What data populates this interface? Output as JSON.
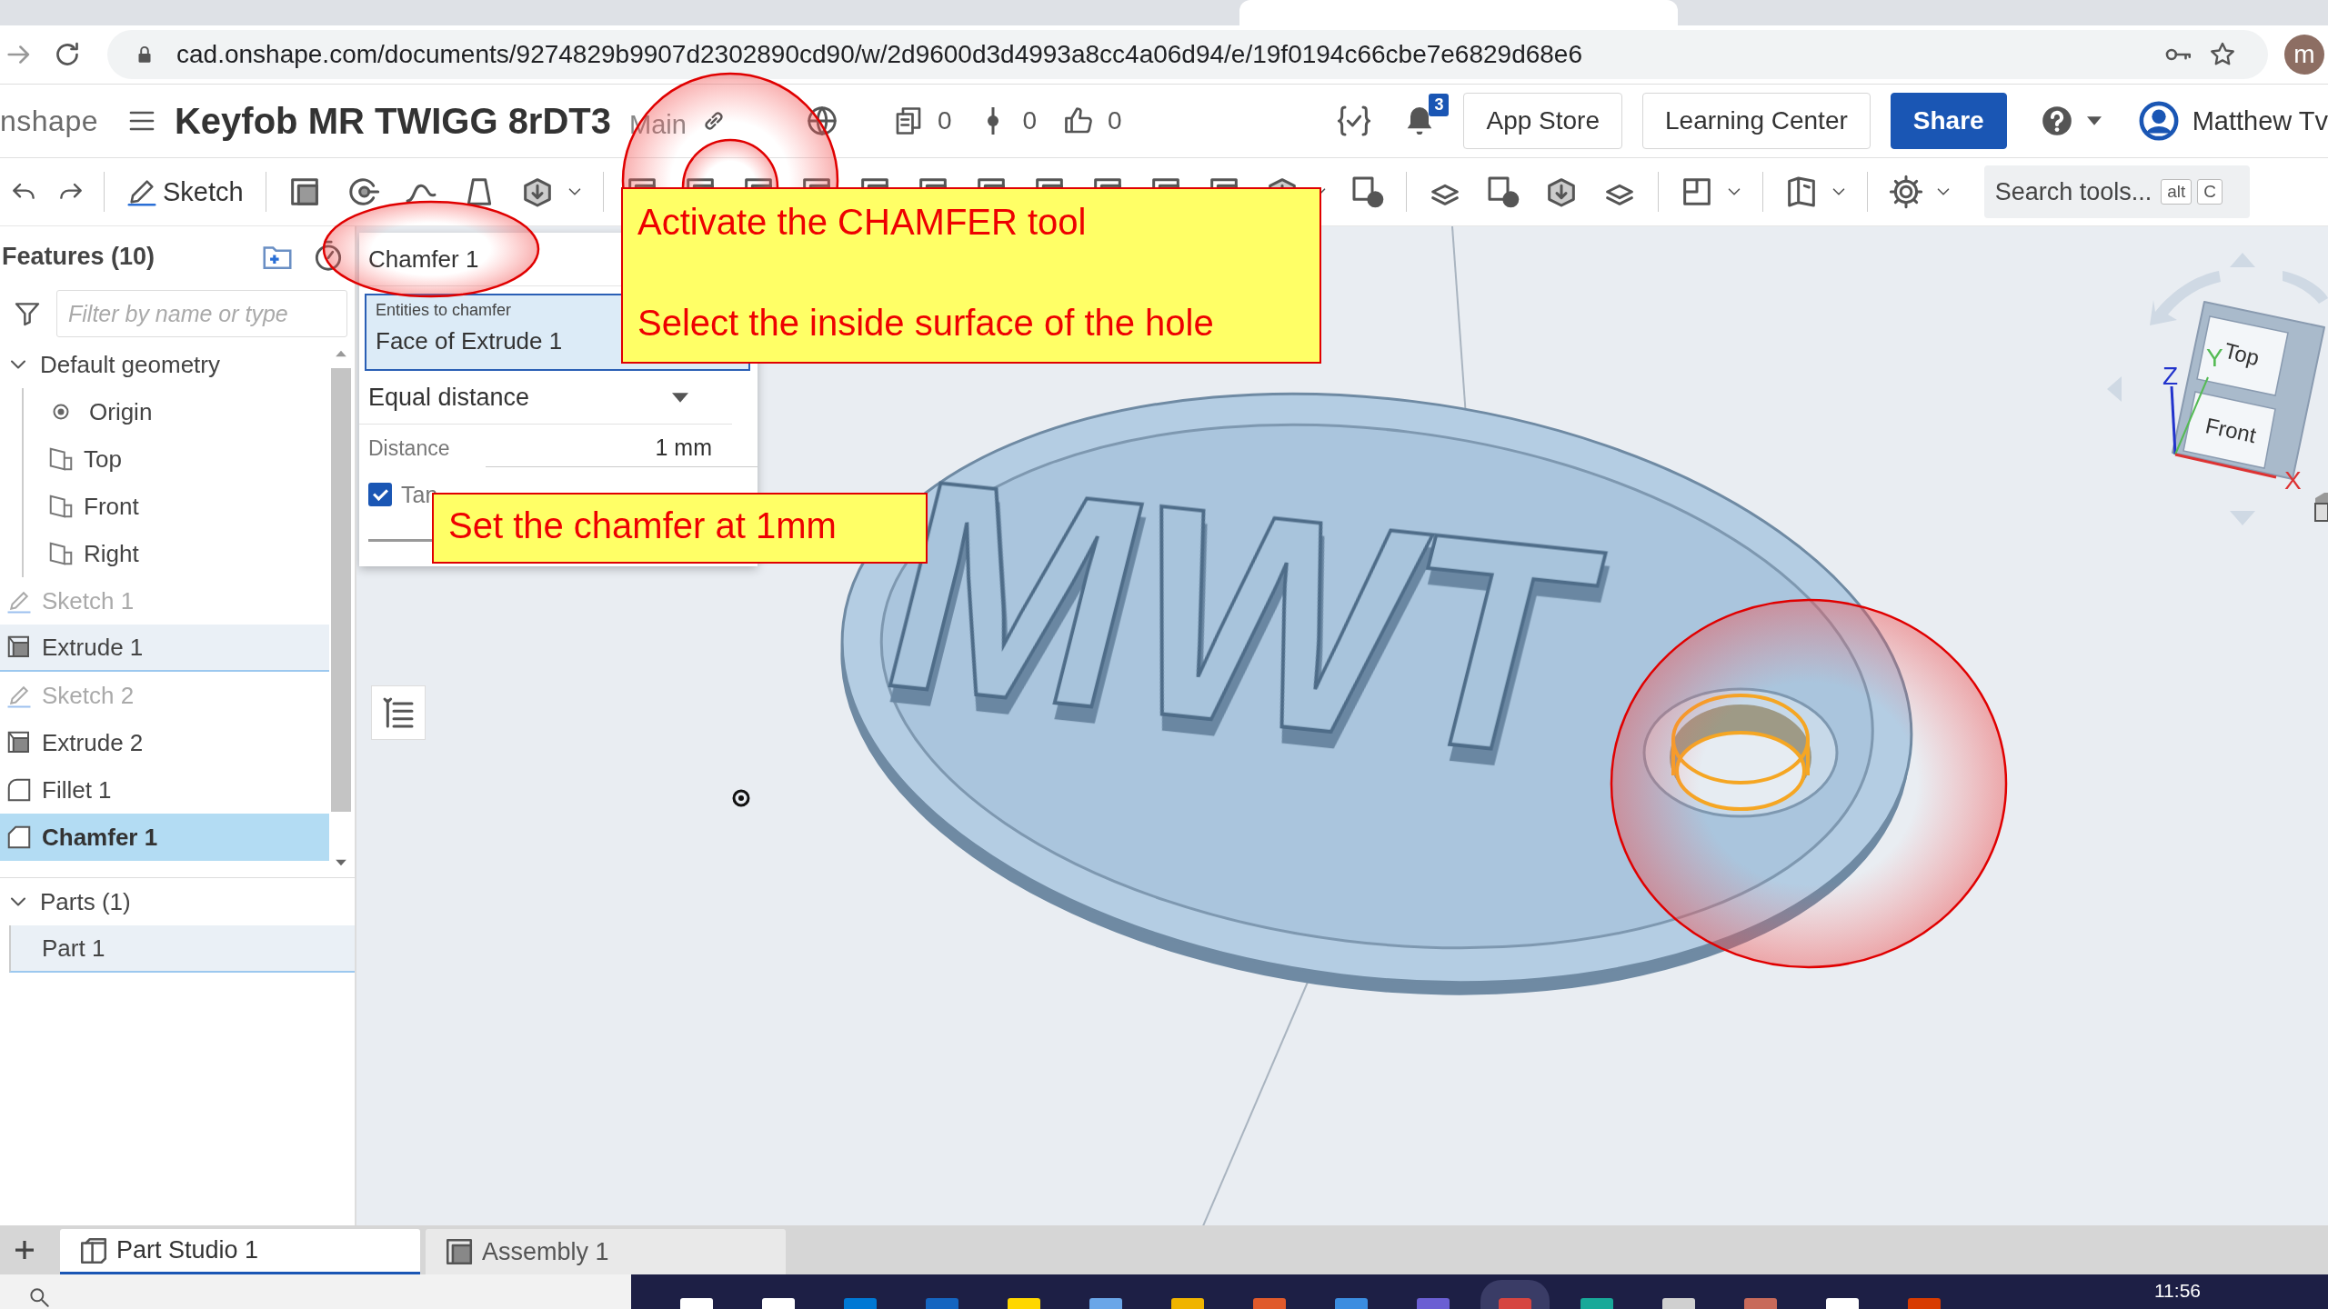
{
  "address_bar": {
    "url": "cad.onshape.com/documents/9274829b9907d2302890cd90/w/2d9600d3d4993a8cc4a06d94/e/19f0194c66cbe7e6829d68e6",
    "profile_initial": "m"
  },
  "header": {
    "logo": "nshape",
    "document_title": "Keyfob MR TWIGG 8rDT3",
    "branch": "Main",
    "counters": [
      {
        "kind": "documents",
        "value": "0"
      },
      {
        "kind": "versions",
        "value": "0"
      },
      {
        "kind": "likes",
        "value": "0"
      }
    ],
    "notification_count": "3",
    "buttons": [
      {
        "label": "App Store",
        "kind": "outline"
      },
      {
        "label": "Learning Center",
        "kind": "outline"
      },
      {
        "label": "Share",
        "kind": "primary"
      }
    ],
    "user": "Matthew Tv"
  },
  "toolbar": {
    "sketch_label": "Sketch",
    "search": {
      "placeholder": "Search tools...",
      "keys": [
        "alt",
        "C"
      ]
    }
  },
  "features": {
    "title": "Features (10)",
    "filter_placeholder": "Filter by name or type",
    "items": [
      {
        "label": "Default geometry",
        "kind": "group",
        "expanded": true,
        "selected": false,
        "highlighted": false,
        "hidden": false,
        "children": [
          {
            "label": "Origin",
            "kind": "origin"
          },
          {
            "label": "Top",
            "kind": "plane"
          },
          {
            "label": "Front",
            "kind": "plane"
          },
          {
            "label": "Right",
            "kind": "plane"
          }
        ]
      },
      {
        "label": "Sketch 1",
        "kind": "sketch",
        "selected": false,
        "highlighted": false,
        "hidden": true
      },
      {
        "label": "Extrude 1",
        "kind": "extrude",
        "selected": false,
        "highlighted": true,
        "hidden": false
      },
      {
        "label": "Sketch 2",
        "kind": "sketch",
        "selected": false,
        "highlighted": false,
        "hidden": true
      },
      {
        "label": "Extrude 2",
        "kind": "extrude",
        "selected": false,
        "highlighted": false,
        "hidden": false
      },
      {
        "label": "Fillet 1",
        "kind": "fillet",
        "selected": false,
        "highlighted": false,
        "hidden": false
      },
      {
        "label": "Chamfer 1",
        "kind": "chamfer",
        "selected": true,
        "highlighted": false,
        "hidden": false
      }
    ]
  },
  "parts": {
    "title": "Parts (1)",
    "expanded": true,
    "items": [
      {
        "label": "Part 1",
        "highlighted": true
      }
    ]
  },
  "dialog": {
    "title": "Chamfer 1",
    "entities_label": "Entities to chamfer",
    "entities_value": "Face of Extrude 1",
    "type_value": "Equal distance",
    "distance_label": "Distance",
    "distance_value": "1 mm",
    "tangent": {
      "label": "Tan",
      "checked": true
    }
  },
  "viewport": {
    "model_text": "MWT",
    "view_cube": {
      "top": "Top",
      "front": "Front",
      "x": "X",
      "y": "Y",
      "z": "Z"
    }
  },
  "callouts": [
    {
      "lines": [
        "Activate the CHAMFER tool",
        "Select the inside surface of the hole"
      ]
    },
    {
      "lines": [
        "Set the chamfer at 1mm"
      ]
    }
  ],
  "tabs": [
    {
      "label": "Part Studio 1",
      "kind": "partstudio",
      "selected": true
    },
    {
      "label": "Assembly 1",
      "kind": "assembly",
      "selected": false
    }
  ],
  "taskbar": {
    "clock": "11:56"
  }
}
